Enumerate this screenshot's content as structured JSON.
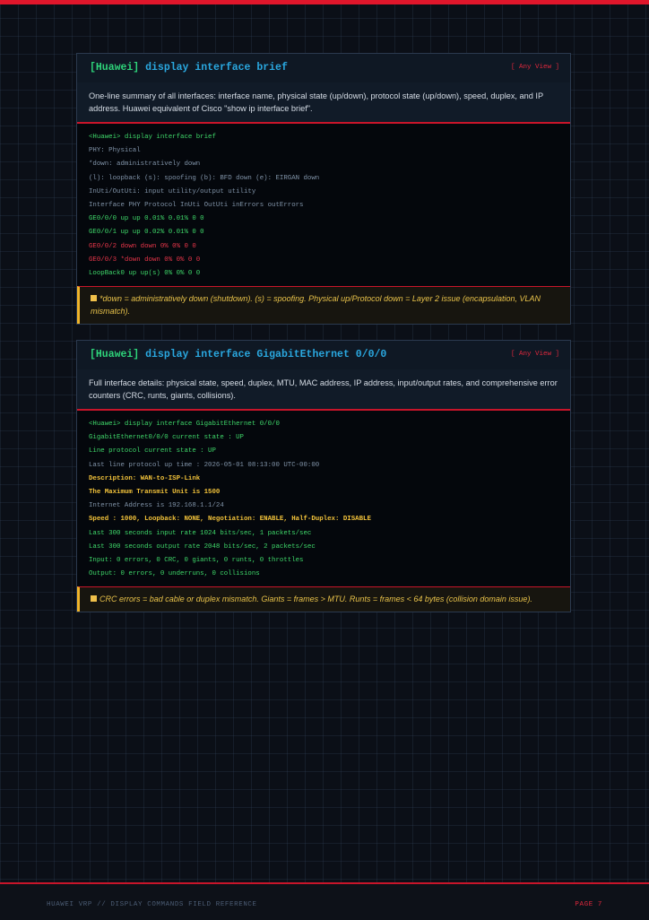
{
  "cards": [
    {
      "vendor_tag": "[Huawei]",
      "command": "display interface brief",
      "view_label": "[ Any View ]",
      "description": "One-line summary of all interfaces: interface name, physical state (up/down), protocol state (up/down), speed, duplex, and IP address. Huawei equivalent of Cisco \"show ip interface brief\".",
      "terminal": [
        "<Huawei> display interface brief",
        "PHY: Physical",
        "*down: administratively down",
        "(l): loopback (s): spoofing (b): BFD down (e): EIRGAN down",
        "InUti/OutUti: input utility/output utility",
        "Interface PHY Protocol InUti OutUti inErrors outErrors",
        "GE0/0/0 up up 0.01% 0.01% 0 0",
        "GE0/0/1 up up 0.02% 0.01% 0 0",
        "GE0/0/2 down down 0% 0% 0 0",
        "GE0/0/3 *down down 0% 0% 0 0",
        "LoopBack0 up up(s) 0% 0% 0 0"
      ],
      "note": "*down = administratively down (shutdown). (s) = spoofing. Physical up/Protocol down = Layer 2 issue (encapsulation, VLAN mismatch)."
    },
    {
      "vendor_tag": "[Huawei]",
      "command": "display interface GigabitEthernet 0/0/0",
      "view_label": "[ Any View ]",
      "description": "Full interface details: physical state, speed, duplex, MTU, MAC address, IP address, input/output rates, and comprehensive error counters (CRC, runts, giants, collisions).",
      "terminal": [
        "<Huawei> display interface GigabitEthernet 0/0/0",
        "GigabitEthernet0/0/0 current state : UP",
        "Line protocol current state : UP",
        "Last line protocol up time : 2026-05-01 08:13:00 UTC-00:00",
        "Description: WAN-to-ISP-Link",
        "The Maximum Transmit Unit is 1500",
        "Internet Address is 192.168.1.1/24",
        "Speed : 1000, Loopback: NONE, Negotiation: ENABLE, Half-Duplex: DISABLE",
        "Last 300 seconds input rate 1024 bits/sec, 1 packets/sec",
        "Last 300 seconds output rate 2048 bits/sec, 2 packets/sec",
        "Input: 0 errors, 0 CRC, 0 giants, 0 runts, 0 throttles",
        "Output: 0 errors, 0 underruns, 0 collisions"
      ],
      "note": "CRC errors = bad cable or duplex mismatch. Giants = frames > MTU. Runts = frames < 64 bytes (collision domain issue)."
    }
  ],
  "footer": {
    "left": "HUAWEI VRP  //  DISPLAY COMMANDS FIELD REFERENCE",
    "right": "PAGE 7"
  },
  "colors": {
    "accent_red": "#e0162b",
    "title_blue": "#2aa8e0",
    "terminal_green": "#3fd86a",
    "terminal_red": "#e8364a",
    "highlight_yellow": "#f2c23a",
    "note_amber": "#e8c24a"
  },
  "icons": {
    "note_marker": "square-bullet-icon"
  }
}
